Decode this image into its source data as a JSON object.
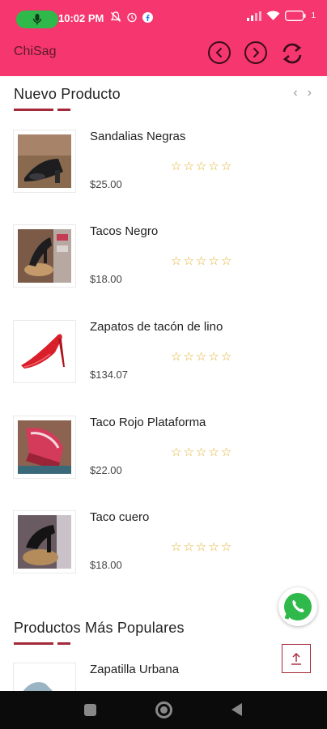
{
  "status_bar": {
    "time": "10:02 PM",
    "battery": "1"
  },
  "app_bar": {
    "title": "ChiSag"
  },
  "sections": {
    "new_products": {
      "title": "Nuevo Producto",
      "items": [
        {
          "name": "Sandalias Negras",
          "price": "$25.00",
          "rating": 0
        },
        {
          "name": "Tacos Negro",
          "price": "$18.00",
          "rating": 0
        },
        {
          "name": "Zapatos de tacón de lino",
          "price": "$134.07",
          "rating": 0
        },
        {
          "name": "Taco Rojo Plataforma",
          "price": "$22.00",
          "rating": 0
        },
        {
          "name": "Taco cuero",
          "price": "$18.00",
          "rating": 0
        }
      ]
    },
    "popular_products": {
      "title": "Productos Más Populares",
      "items": [
        {
          "name": "Zapatilla Urbana"
        }
      ]
    }
  },
  "colors": {
    "primary": "#f5366f",
    "accent": "#a3283a",
    "star": "#e0b12d",
    "whatsapp": "#2fb94a"
  }
}
